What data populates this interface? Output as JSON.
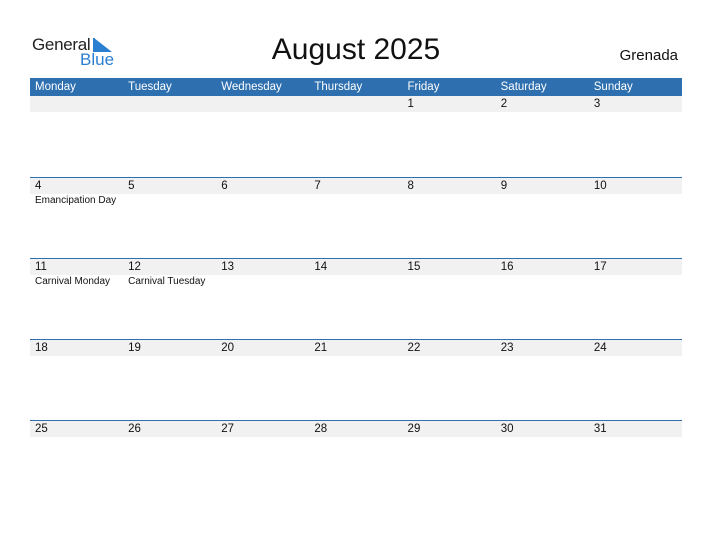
{
  "logo": {
    "line1": "General",
    "line2": "Blue"
  },
  "title": "August 2025",
  "country": "Grenada",
  "weekdays": [
    "Monday",
    "Tuesday",
    "Wednesday",
    "Thursday",
    "Friday",
    "Saturday",
    "Sunday"
  ],
  "weeks": [
    [
      {
        "day": ""
      },
      {
        "day": ""
      },
      {
        "day": ""
      },
      {
        "day": ""
      },
      {
        "day": "1"
      },
      {
        "day": "2"
      },
      {
        "day": "3"
      }
    ],
    [
      {
        "day": "4",
        "event": "Emancipation Day"
      },
      {
        "day": "5"
      },
      {
        "day": "6"
      },
      {
        "day": "7"
      },
      {
        "day": "8"
      },
      {
        "day": "9"
      },
      {
        "day": "10"
      }
    ],
    [
      {
        "day": "11",
        "event": "Carnival Monday"
      },
      {
        "day": "12",
        "event": "Carnival Tuesday"
      },
      {
        "day": "13"
      },
      {
        "day": "14"
      },
      {
        "day": "15"
      },
      {
        "day": "16"
      },
      {
        "day": "17"
      }
    ],
    [
      {
        "day": "18"
      },
      {
        "day": "19"
      },
      {
        "day": "20"
      },
      {
        "day": "21"
      },
      {
        "day": "22"
      },
      {
        "day": "23"
      },
      {
        "day": "24"
      }
    ],
    [
      {
        "day": "25"
      },
      {
        "day": "26"
      },
      {
        "day": "27"
      },
      {
        "day": "28"
      },
      {
        "day": "29"
      },
      {
        "day": "30"
      },
      {
        "day": "31"
      }
    ]
  ],
  "colors": {
    "header": "#2e6fb0",
    "accent": "#2a7fd0",
    "strip": "#f1f1f1"
  }
}
